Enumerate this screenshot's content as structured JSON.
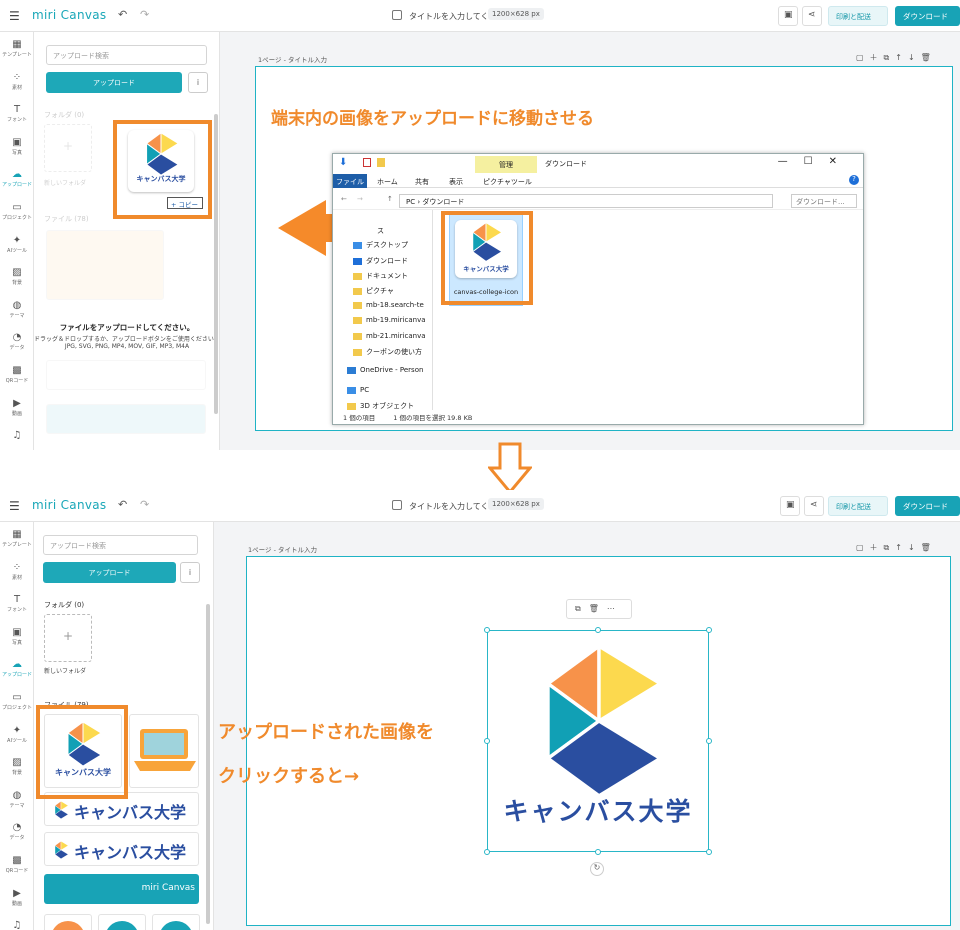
{
  "app": {
    "logo": "miri Canvas",
    "doc_title": "タイトルを入力してく...",
    "size_label": "1200×628 px",
    "print_label": "印刷と配送",
    "download_label": "ダウンロード"
  },
  "iconbar": {
    "items": [
      {
        "label": "テンプレート",
        "icon": "template-icon",
        "glyph": "▦"
      },
      {
        "label": "素材",
        "icon": "elements-icon",
        "glyph": "⁘"
      },
      {
        "label": "フォント",
        "icon": "font-icon",
        "glyph": "T"
      },
      {
        "label": "写真",
        "icon": "photo-icon",
        "glyph": "▣"
      },
      {
        "label": "アップロード",
        "icon": "upload-icon",
        "glyph": "☁"
      },
      {
        "label": "プロジェクト",
        "icon": "project-icon",
        "glyph": "▭"
      },
      {
        "label": "AIツール",
        "icon": "ai-tool-icon",
        "glyph": "✦"
      },
      {
        "label": "背景",
        "icon": "background-icon",
        "glyph": "▨"
      },
      {
        "label": "テーマ",
        "icon": "theme-icon",
        "glyph": "◍"
      },
      {
        "label": "データ",
        "icon": "data-icon",
        "glyph": "◔"
      },
      {
        "label": "QRコード",
        "icon": "qr-icon",
        "glyph": "▩"
      },
      {
        "label": "動画",
        "icon": "video-icon",
        "glyph": "▶"
      },
      {
        "label": "",
        "icon": "music-icon",
        "glyph": "♫"
      }
    ]
  },
  "side": {
    "search_placeholder": "アップロード検索",
    "upload_label": "アップロード",
    "info_glyph": "i",
    "folder_heading": "フォルダ (0)",
    "new_folder_label": "新しいフォルダ",
    "files_heading_top": "ファイル (78)",
    "files_heading_bottom": "ファイル (79)",
    "drop_title": "ファイルをアップロードしてください。",
    "drop_desc": "ドラッグ＆ドロップするか、アップロードボタンをご使用ください。",
    "drop_formats": "JPG, SVG, PNG, MP4, MOV, GIF, MP3, M4A",
    "copy_badge": "+ コピー",
    "banner_text": "miri Canvas"
  },
  "canvas": {
    "page_label": "1ページ - タイトル入力",
    "tools": "▢＋⧉↑↓🗑",
    "instruction_top": "端末内の画像をアップロードに移動させる",
    "instruction_bottom_1": "アップロードされた画像を",
    "instruction_bottom_2": "クリックすると→",
    "logo_caption": "キャンバス大学",
    "floating_tools": "⧉🗑⋯",
    "rotate_glyph": "↻"
  },
  "explorer": {
    "manage_tab": "管理",
    "window_title": "ダウンロード",
    "win_controls": "—☐✕",
    "ribbon_tabs": [
      "ファイル",
      "ホーム",
      "共有",
      "表示",
      "ピクチャツール"
    ],
    "address": "PC › ダウンロード",
    "search_placeholder": "ダウンロード...",
    "nav_items": [
      "デスクトップ",
      "ダウンロード",
      "ドキュメント",
      "ピクチャ",
      "mb-18.search-te",
      "mb-19.miricanva",
      "mb-21.miricanva",
      "クーポンの使い方",
      "OneDrive - Person",
      "PC",
      "3D オブジェクト"
    ],
    "nav_partial": "ス",
    "file_name": "canvas-college-icon",
    "status_items": "1 個の項目",
    "status_selected": "1 個の項目を選択  19.8 KB"
  },
  "colors": {
    "accent": "#18a3b6",
    "highlight": "#f08a2c",
    "logo_orange": "#f7924a",
    "logo_yellow": "#fcd94e",
    "logo_teal": "#11a0b5",
    "logo_blue": "#2a4ea0"
  }
}
